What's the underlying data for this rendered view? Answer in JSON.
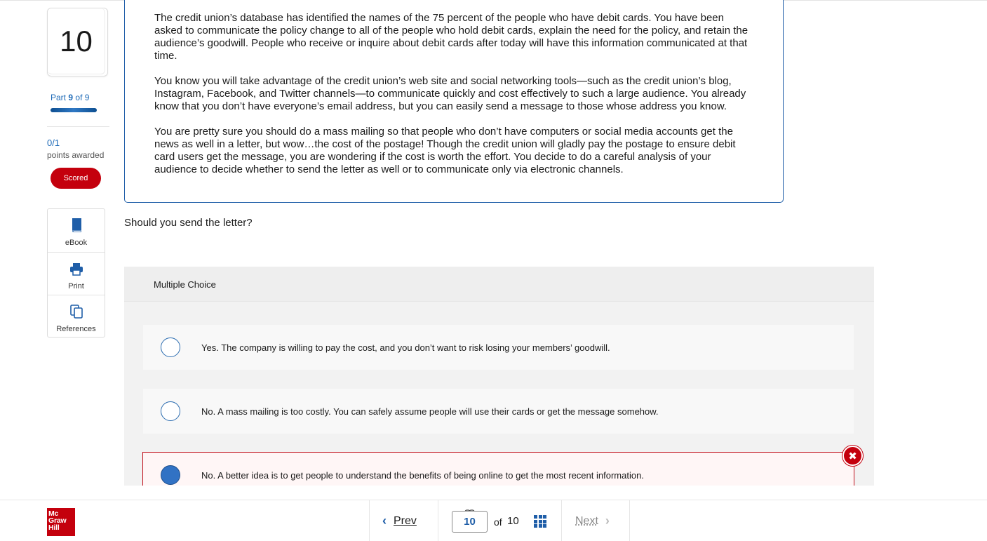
{
  "sidebar": {
    "question_number": "10",
    "part_prefix": "Part",
    "part_current": "9",
    "part_of": "of 9",
    "points": "0/1",
    "points_label": "points awarded",
    "scored_label": "Scored",
    "tools": [
      {
        "label": "eBook",
        "icon": "book-icon"
      },
      {
        "label": "Print",
        "icon": "printer-icon"
      },
      {
        "label": "References",
        "icon": "copy-icon"
      }
    ]
  },
  "passage": {
    "paragraphs": [
      "The credit union’s database has identified the names of the 75 percent of the people who have debit cards. You have been asked to communicate the policy change to all of the people who hold debit cards, explain the need for the policy, and retain the audience’s goodwill. People who receive or inquire about debit cards after today will have this information communicated at that time.",
      "You know you will take advantage of the credit union’s web site and social networking tools—such as the credit union’s blog, Instagram, Facebook, and Twitter channels—to communicate quickly and cost effectively to such a large audience. You already know that you don’t have everyone’s email address, but you can easily send a message to those whose address you know.",
      "You are pretty sure you should do a mass mailing so that people who don’t have computers or social media accounts get the news as well in a letter, but wow…the cost of the postage! Though the credit union will gladly pay the postage to ensure debit card users get the message, you are wondering if the cost is worth the effort. You decide to do a careful analysis of your audience to decide whether to send the letter as well or to communicate only via electronic channels."
    ]
  },
  "question": "Should you send the letter?",
  "mc": {
    "title": "Multiple Choice",
    "options": [
      {
        "text": "Yes. The company is willing to pay the cost, and you don’t want to risk losing your members’ goodwill.",
        "selected": false
      },
      {
        "text": "No. A mass mailing is too costly. You can safely assume people will use their cards or get the message somehow.",
        "selected": false
      },
      {
        "text": "No. A better idea is to get people to understand the benefits of being online to get the most recent information.",
        "selected": true,
        "status": "incorrect"
      }
    ]
  },
  "footer": {
    "logo_lines": [
      "Mc",
      "Graw",
      "Hill"
    ],
    "prev_label": "Prev",
    "page_value": "10",
    "of_label": "of",
    "total_pages": "10",
    "next_label": "Next"
  },
  "colors": {
    "accent": "#1f5ea8",
    "error": "#c4000d"
  }
}
